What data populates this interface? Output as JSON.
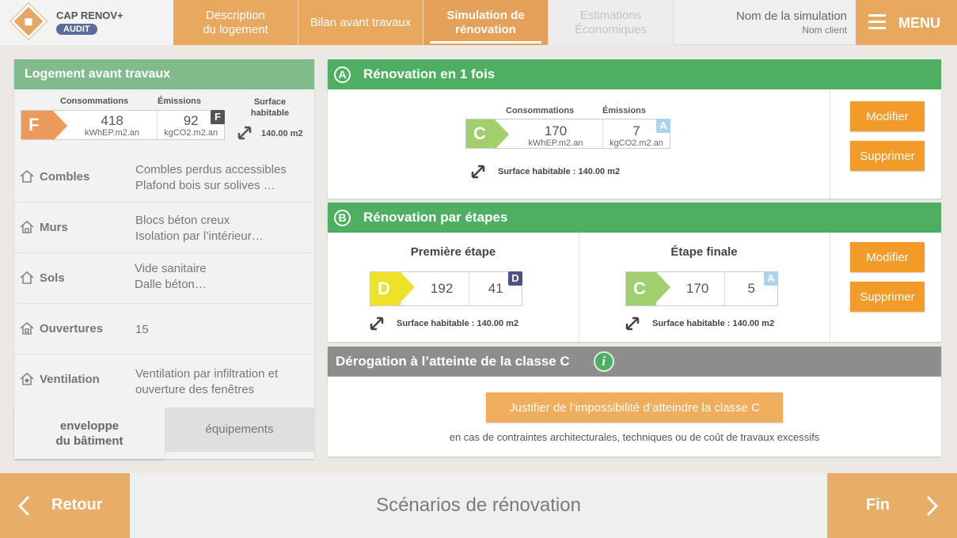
{
  "header": {
    "app_name": "CAP RENOV+",
    "app_badge": "AUDIT",
    "tabs": [
      {
        "label": "Description\ndu logement",
        "state": "done"
      },
      {
        "label": "Bilan avant travaux",
        "state": "done"
      },
      {
        "label": "Simulation de\nrénovation",
        "state": "active"
      },
      {
        "label": "Estimations\nÉconomiques",
        "state": "disabled"
      }
    ],
    "simulation_name": "Nom de la simulation",
    "client_name": "Nom client",
    "menu_label": "MENU"
  },
  "before": {
    "title": "Logement avant travaux",
    "consumption_label": "Consommations",
    "emissions_label": "Émissions",
    "surface_label": "Surface\nhabitable",
    "energy_class": "F",
    "energy_class_color": "#ec9a5b",
    "consumption_value": "418",
    "consumption_unit": "kWhEP.m2.an",
    "emissions_value": "92",
    "emissions_unit": "kgCO2.m2.an",
    "ges_class": "F",
    "ges_class_color": "#555555",
    "surface_value": "140.00 m2",
    "rows": [
      {
        "label": "Combles",
        "value": "Combles perdus accessibles\nPlafond bois sur solives …",
        "icon": "roof-icon"
      },
      {
        "label": "Murs",
        "value": "Blocs béton creux\nIsolation par l’intérieur…",
        "icon": "wall-icon"
      },
      {
        "label": "Sols",
        "value": "Vide sanitaire\nDalle béton…",
        "icon": "floor-icon"
      },
      {
        "label": "Ouvertures",
        "value": "15",
        "icon": "window-icon"
      },
      {
        "label": "Ventilation",
        "value": "Ventilation par infiltration et\nouverture des fenêtres",
        "icon": "ventilation-icon"
      }
    ],
    "tabs": [
      "enveloppe\ndu bâtiment",
      "équipements"
    ]
  },
  "scenario_a": {
    "letter": "A",
    "title": "Rénovation en 1 fois",
    "consumption_label": "Consommations",
    "emissions_label": "Émissions",
    "energy_class": "C",
    "energy_class_color": "#a2cf6e",
    "consumption_value": "170",
    "consumption_unit": "kWhEP.m2.an",
    "emissions_value": "7",
    "emissions_unit": "kgCO2.m2.an",
    "ges_class": "A",
    "ges_class_color": "#a9d4f0",
    "surface": "Surface habitable : 140.00 m2",
    "modify": "Modifier",
    "delete": "Supprimer"
  },
  "scenario_b": {
    "letter": "B",
    "title": "Rénovation par étapes",
    "steps": [
      {
        "title": "Première étape",
        "energy_class": "D",
        "energy_class_color": "#ede12a",
        "consumption": "192",
        "emissions": "41",
        "ges_class": "D",
        "ges_class_color": "#4a5288",
        "surface": "Surface habitable : 140.00 m2"
      },
      {
        "title": "Étape finale",
        "energy_class": "C",
        "energy_class_color": "#a2cf6e",
        "consumption": "170",
        "emissions": "5",
        "ges_class": "A",
        "ges_class_color": "#a9d4f0",
        "surface": "Surface habitable : 140.00 m2"
      }
    ],
    "modify": "Modifier",
    "delete": "Supprimer"
  },
  "derogation": {
    "title": "Dérogation à l’atteinte de la classe C",
    "button": "Justifier de l’impossibilité d’atteindre la classe C",
    "note": "en cas de contraintes architecturales, techniques ou de coût de travaux excessifs"
  },
  "footer": {
    "back": "Retour",
    "title": "Scénarios de rénovation",
    "next": "Fin"
  }
}
